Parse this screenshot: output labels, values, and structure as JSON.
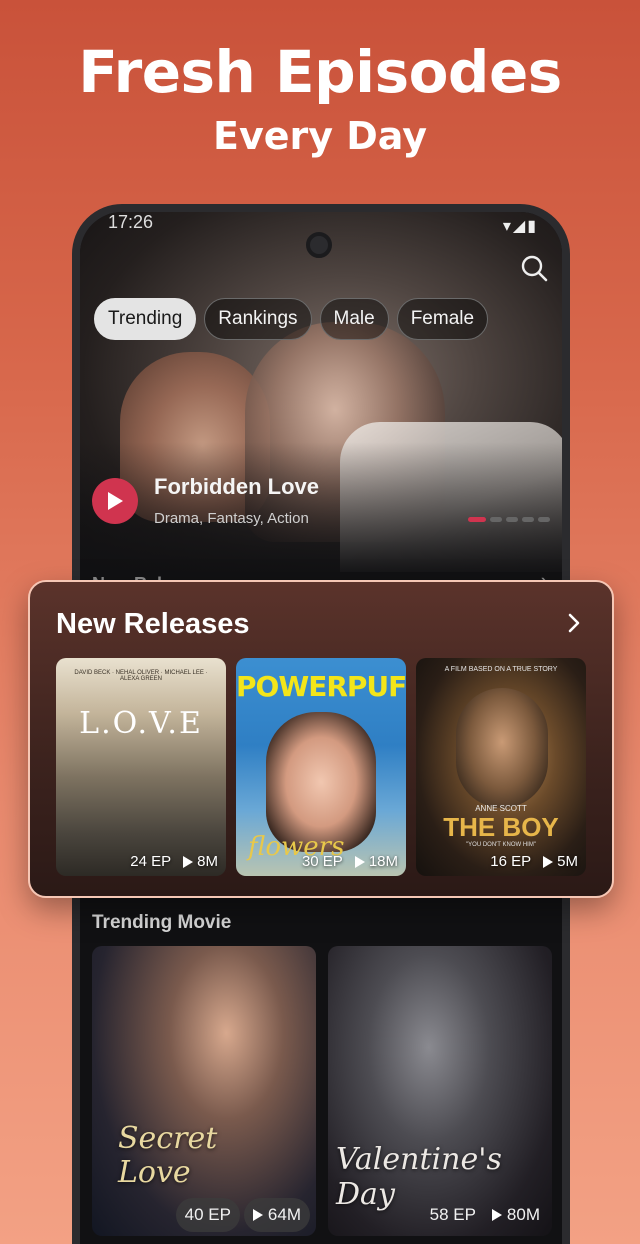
{
  "headline": "Fresh Episodes",
  "subline": "Every Day",
  "status": {
    "time": "17:26",
    "icons": "▾◢▮"
  },
  "tabs": [
    {
      "label": "Trending",
      "active": true
    },
    {
      "label": "Rankings",
      "active": false
    },
    {
      "label": "Male",
      "active": false
    },
    {
      "label": "Female",
      "active": false
    }
  ],
  "hero": {
    "title": "Forbidden Love",
    "genres": "Drama, Fantasy, Action",
    "carousel_pages": 5,
    "carousel_active": 0
  },
  "ghost_section": {
    "title": "New Releases"
  },
  "new_releases": {
    "title": "New Releases",
    "items": [
      {
        "poster_title": "L.O.V.E",
        "poster_credits": "DAVID BECK · NEHAL OLIVER · MICHAEL LEE · ALEXA GREEN",
        "episodes": "24 EP",
        "views": "8M"
      },
      {
        "poster_title": "POWERPUFF",
        "poster_subtitle": "flowers",
        "episodes": "30 EP",
        "views": "18M"
      },
      {
        "poster_tag": "A FILM BASED ON A TRUE STORY",
        "poster_author": "ANNE SCOTT",
        "poster_title": "THE BOY",
        "poster_quote": "\"YOU DON'T KNOW HIM\"",
        "episodes": "16 EP",
        "views": "5M"
      }
    ]
  },
  "trending_movie": {
    "title": "Trending Movie",
    "items": [
      {
        "poster_title": "Secret Love",
        "episodes": "40 EP",
        "views": "64M"
      },
      {
        "poster_title": "Valentine's Day",
        "episodes": "58 EP",
        "views": "80M"
      }
    ]
  },
  "colors": {
    "accent": "#d0344f",
    "background_top": "#c9523a",
    "background_bottom": "#f3a184"
  }
}
